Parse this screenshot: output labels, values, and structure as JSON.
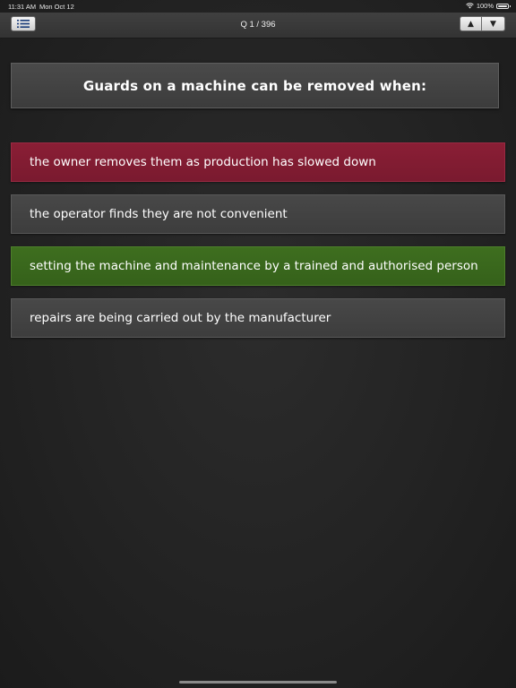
{
  "status_bar": {
    "time": "11:31 AM",
    "date": "Mon Oct 12",
    "battery": "100%",
    "icons": [
      "wifi-icon",
      "battery-icon"
    ]
  },
  "nav": {
    "title": "Q 1 / 396",
    "menu_icon": "list-icon",
    "up_glyph": "▲",
    "down_glyph": "▼"
  },
  "question": {
    "text": "Guards on a machine can be removed when:"
  },
  "answers": [
    {
      "text": "the owner removes them as production has slowed down",
      "state": "wrong",
      "color": "#7f1c32"
    },
    {
      "text": "the operator finds they are not convenient",
      "state": "neutral",
      "color": "#434343"
    },
    {
      "text": "setting the machine and maintenance by a trained and authorised person",
      "state": "correct",
      "color": "#3a671c"
    },
    {
      "text": "repairs are being carried out by the manufacturer",
      "state": "neutral",
      "color": "#434343"
    }
  ]
}
